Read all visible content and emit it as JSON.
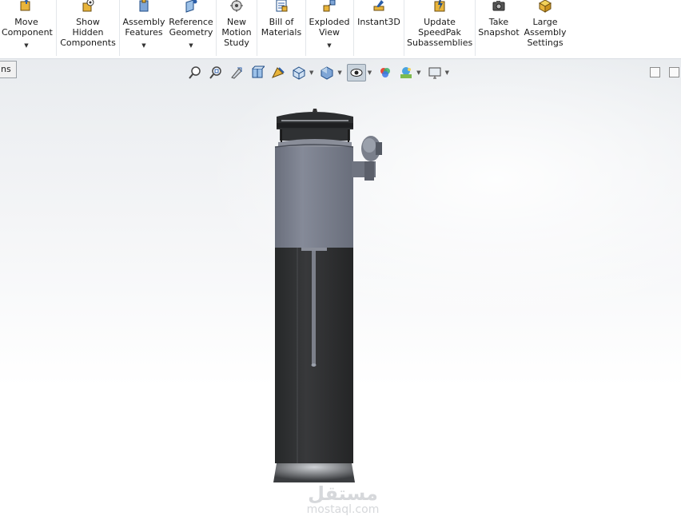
{
  "ribbon": {
    "buttons": [
      {
        "label": "Move\nComponent",
        "icon": "move-component-icon",
        "caret": true
      },
      {
        "label": "Show\nHidden\nComponents",
        "icon": "show-hidden-components-icon",
        "caret": false
      },
      {
        "label": "Assembly\nFeatures",
        "icon": "assembly-features-icon",
        "caret": true
      },
      {
        "label": "Reference\nGeometry",
        "icon": "reference-geometry-icon",
        "caret": true
      },
      {
        "label": "New\nMotion\nStudy",
        "icon": "motion-study-icon",
        "caret": false
      },
      {
        "label": "Bill of\nMaterials",
        "icon": "bill-of-materials-icon",
        "caret": false
      },
      {
        "label": "Exploded\nView",
        "icon": "exploded-view-icon",
        "caret": true
      },
      {
        "label": "Instant3D",
        "icon": "instant3d-icon",
        "caret": false
      },
      {
        "label": "Update\nSpeedPak\nSubassemblies",
        "icon": "speedpak-icon",
        "caret": false
      },
      {
        "label": "Take\nSnapshot",
        "icon": "camera-icon",
        "caret": false
      },
      {
        "label": "Large\nAssembly\nSettings",
        "icon": "large-assembly-icon",
        "caret": false
      }
    ]
  },
  "sidebar_tab": {
    "label": "ns"
  },
  "heads_up_toolbar": [
    "zoom-to-fit-icon",
    "zoom-to-area-icon",
    "previous-view-icon",
    "section-view-icon",
    "dynamic-annotation-icon",
    "view-orientation-icon",
    "display-style-icon",
    "hide-show-items-icon",
    "edit-appearance-icon",
    "apply-scene-icon",
    "view-settings-icon"
  ],
  "watermark": {
    "arabic": "مستقل",
    "latin": "mostaql.com"
  },
  "colors": {
    "accent": "#1f6fb5",
    "model_dark": "#2f3133",
    "model_gray": "#7d8290"
  }
}
